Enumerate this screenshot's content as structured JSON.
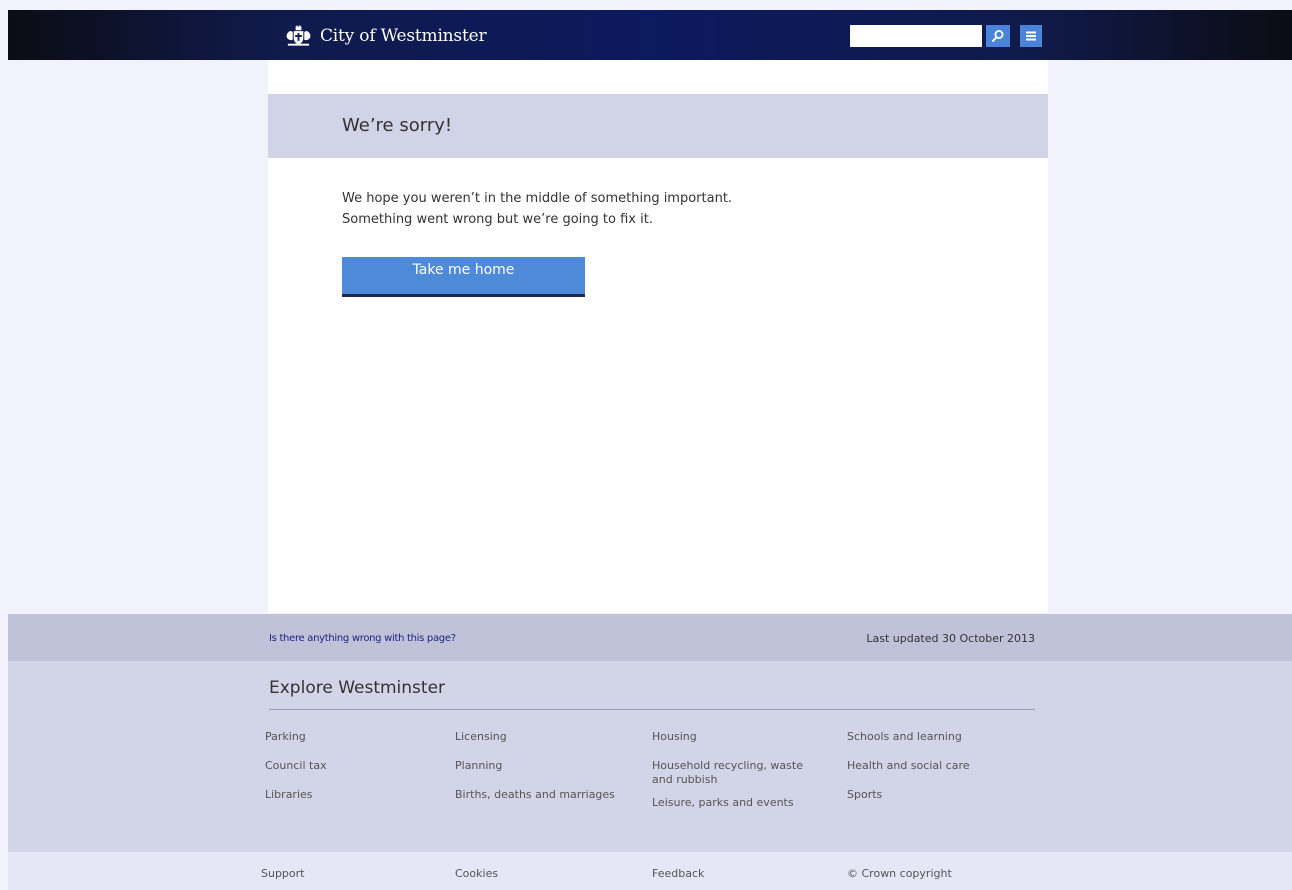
{
  "header": {
    "site_name": "City of Westminster",
    "search": {
      "value": "",
      "placeholder": ""
    },
    "search_icon": "magnifier-icon",
    "menu_icon": "hamburger-menu-icon"
  },
  "error": {
    "title": "We’re sorry!",
    "line1": "We hope you weren’t in the middle of something important.",
    "line2": "Something went wrong but we’re going to fix it.",
    "button_label": "Take me home"
  },
  "feedback": {
    "report_link": "Is there anything wrong with this page?",
    "last_updated": "Last updated  30 October 2013"
  },
  "explore": {
    "title": "Explore Westminster",
    "columns": [
      [
        "Parking",
        "Council tax",
        "Libraries"
      ],
      [
        "Licensing",
        "Planning",
        "Births, deaths and marriages"
      ],
      [
        "Housing",
        "Household recycling, waste and rubbish",
        "Leisure, parks and events"
      ],
      [
        "Schools and learning",
        "Health and social care",
        "Sports"
      ]
    ]
  },
  "footer": {
    "links": [
      "Support",
      "Cookies",
      "Feedback",
      "© Crown copyright"
    ]
  },
  "colors": {
    "header_navy": "#0c1a5e",
    "button_blue": "#4f8ad8",
    "banner_lavender": "#d1d3e6",
    "footer_lavender": "#d2d4e7",
    "link_navy": "#1a2680"
  }
}
